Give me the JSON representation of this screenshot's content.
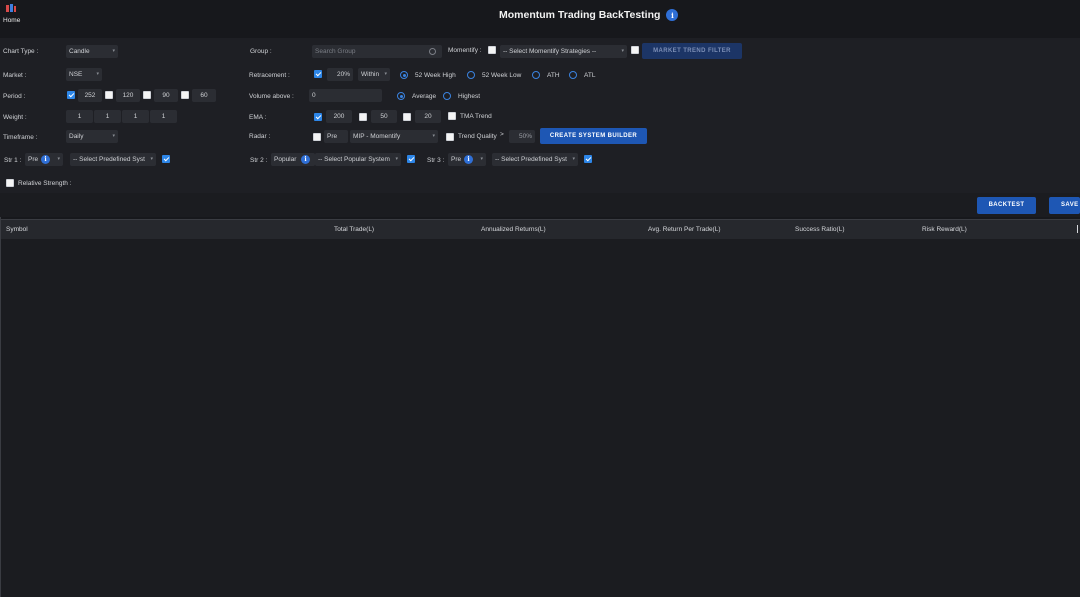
{
  "header": {
    "home_label": "Home",
    "title": "Momentum Trading BackTesting"
  },
  "form": {
    "chart_type": {
      "label": "Chart Type :",
      "value": "Candle"
    },
    "market": {
      "label": "Market :",
      "value": "NSE"
    },
    "period": {
      "label": "Period :",
      "values": [
        "252",
        "120",
        "90",
        "60"
      ],
      "checked": [
        true,
        false,
        false,
        false
      ]
    },
    "weight": {
      "label": "Weight :",
      "values": [
        "1",
        "1",
        "1",
        "1"
      ]
    },
    "timeframe": {
      "label": "Timeframe :",
      "value": "Daily"
    },
    "str1": {
      "label": "Str 1 :",
      "type_value": "Pre",
      "select_value": "-- Select Predefined Syst",
      "checked": true
    },
    "relative_strength": {
      "label": "Relative Strength :",
      "checked": false
    },
    "group": {
      "label": "Group :",
      "placeholder": "Search Group"
    },
    "retracement": {
      "label": "Retracement :",
      "checked": true,
      "value": "20",
      "unit": "%",
      "mode": "Within",
      "options": [
        "52 Week High",
        "52 Week Low",
        "ATH",
        "ATL"
      ],
      "selected": "52 Week High"
    },
    "volume_above": {
      "label": "Volume above :",
      "value": "0",
      "options": [
        "Average",
        "Highest"
      ],
      "selected": "Average"
    },
    "ema": {
      "label": "EMA :",
      "values": [
        "200",
        "50",
        "20"
      ],
      "checked": [
        true,
        false,
        false
      ],
      "tma_label": "TMA Trend",
      "tma_checked": false
    },
    "radar": {
      "label": "Radar :",
      "checked": false,
      "type_value": "Pre",
      "select_value": "MIP - Momentify"
    },
    "trend_quality": {
      "label": "Trend Quality",
      "checked": false,
      "operator": ">",
      "value": "50",
      "unit": "%"
    },
    "create_system_builder": "CREATE SYSTEM BUILDER",
    "str2": {
      "label": "Str 2 :",
      "type_value": "Popular",
      "select_value": "-- Select Popular System",
      "checked": true
    },
    "str3": {
      "label": "Str 3 :",
      "type_value": "Pre",
      "select_value": "-- Select Predefined Syst",
      "checked": true
    },
    "momentify": {
      "label": "Momentify :",
      "checked": false,
      "select_value": "-- Select Momentify Strategies --",
      "filter_checked": false
    },
    "market_trend_filter": "MARKET TREND FILTER"
  },
  "actions": {
    "backtest": "BACKTEST",
    "save": "SAVE"
  },
  "table": {
    "columns": [
      "Symbol",
      "Total Trade(L)",
      "Annualized Returns(L)",
      "Avg. Return Per Trade(L)",
      "Success Ratio(L)",
      "Risk Reward(L)"
    ],
    "rows": []
  },
  "colors": {
    "background": "#17181c",
    "panel": "#1e1f24",
    "accent": "#1e57b4",
    "checkbox": "#2d86e8"
  }
}
